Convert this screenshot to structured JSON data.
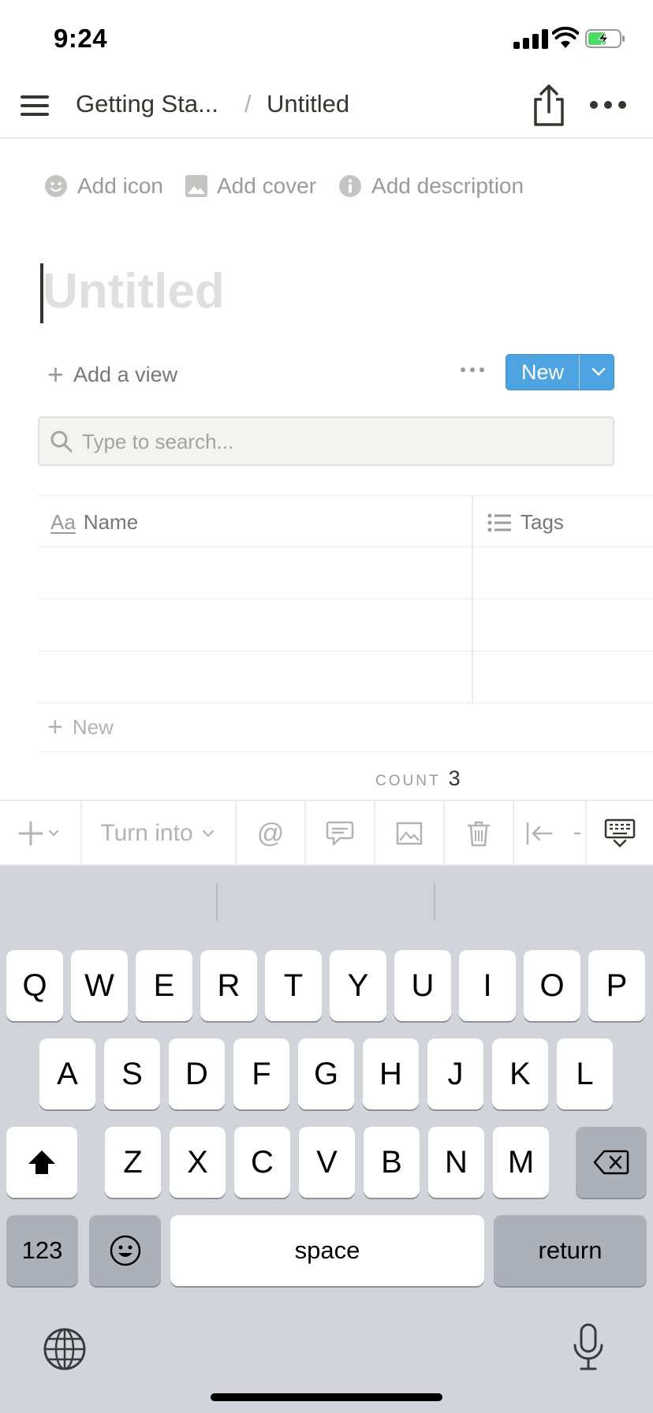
{
  "status_bar": {
    "time": "9:24"
  },
  "nav": {
    "breadcrumb_parent": "Getting Sta...",
    "separator": "/",
    "breadcrumb_current": "Untitled"
  },
  "page_meta": {
    "add_icon": "Add icon",
    "add_cover": "Add cover",
    "add_description": "Add description"
  },
  "page": {
    "title_placeholder": "Untitled"
  },
  "database": {
    "add_view": "Add a view",
    "new_button": "New",
    "search_placeholder": "Type to search...",
    "columns": [
      {
        "label": "Name",
        "icon": "text-aa-icon"
      },
      {
        "label": "Tags",
        "icon": "list-icon"
      }
    ],
    "rows": [
      {
        "name": "",
        "tags": ""
      },
      {
        "name": "",
        "tags": ""
      },
      {
        "name": "",
        "tags": ""
      }
    ],
    "new_row_label": "New",
    "count_label": "COUNT",
    "count_value": "3"
  },
  "toolbar": {
    "turn_into": "Turn into",
    "mention": "@"
  },
  "keyboard": {
    "row1": [
      "Q",
      "W",
      "E",
      "R",
      "T",
      "Y",
      "U",
      "I",
      "O",
      "P"
    ],
    "row2": [
      "A",
      "S",
      "D",
      "F",
      "G",
      "H",
      "J",
      "K",
      "L"
    ],
    "row3": [
      "Z",
      "X",
      "C",
      "V",
      "B",
      "N",
      "M"
    ],
    "numbers": "123",
    "space": "space",
    "return": "return"
  },
  "colors": {
    "accent": "#4ea4e0",
    "keyboard_bg": "#d1d4da",
    "text": "#37352f"
  }
}
